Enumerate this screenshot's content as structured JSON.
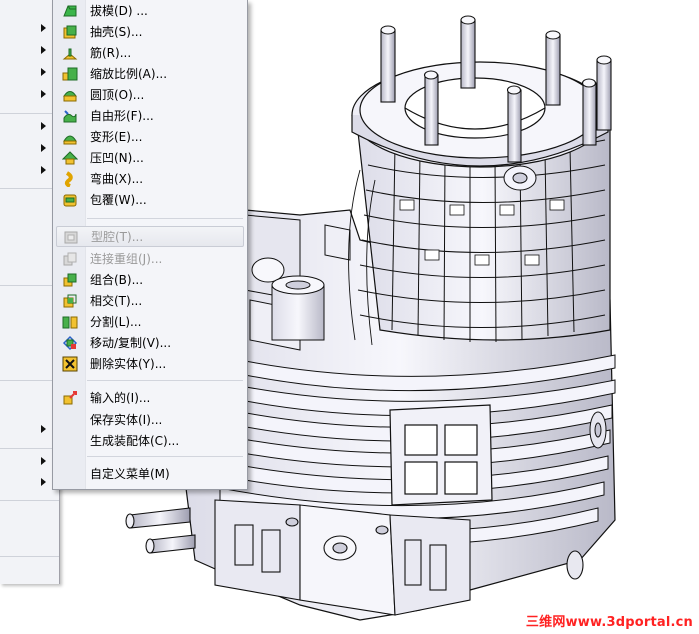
{
  "menu": {
    "items": [
      {
        "label": "拔模(D) ...",
        "icon": "draft-icon",
        "enabled": true
      },
      {
        "label": "抽壳(S)...",
        "icon": "shell-icon",
        "enabled": true
      },
      {
        "label": "筋(R)...",
        "icon": "rib-icon",
        "enabled": true
      },
      {
        "label": "缩放比例(A)...",
        "icon": "scale-icon",
        "enabled": true
      },
      {
        "label": "圆顶(O)...",
        "icon": "dome-icon",
        "enabled": true
      },
      {
        "label": "自由形(F)...",
        "icon": "freeform-icon",
        "enabled": true
      },
      {
        "label": "变形(E)...",
        "icon": "deform-icon",
        "enabled": true
      },
      {
        "label": "压凹(N)...",
        "icon": "indent-icon",
        "enabled": true
      },
      {
        "label": "弯曲(X)...",
        "icon": "flex-icon",
        "enabled": true
      },
      {
        "label": "包覆(W)...",
        "icon": "wrap-icon",
        "enabled": true
      },
      {
        "label": "型腔(T)...",
        "icon": "cavity-icon",
        "enabled": false
      },
      {
        "label": "连接重组(J)...",
        "icon": "join-icon",
        "enabled": false
      },
      {
        "label": "组合(B)...",
        "icon": "combine-icon",
        "enabled": true
      },
      {
        "label": "相交(T)...",
        "icon": "intersect-icon",
        "enabled": true
      },
      {
        "label": "分割(L)...",
        "icon": "split-icon",
        "enabled": true
      },
      {
        "label": "移动/复制(V)...",
        "icon": "move-copy-icon",
        "enabled": true
      },
      {
        "label": "删除实体(Y)...",
        "icon": "delete-body-icon",
        "enabled": true
      },
      {
        "label": "输入的(I)...",
        "icon": "imported-icon",
        "enabled": true
      },
      {
        "label": "保存实体(I)...",
        "icon": "save-bodies-icon",
        "enabled": true
      },
      {
        "label": "生成装配体(C)...",
        "icon": "create-assembly-icon",
        "enabled": true
      },
      {
        "label": "自定义菜单(M)",
        "icon": "",
        "enabled": true
      }
    ],
    "highlighted": "型腔(T)..."
  },
  "watermark": "三维网www.3dportal.cn",
  "colors": {
    "menu_bg": "#f4f5f9",
    "disabled_text": "#9a9a9a",
    "model_fill": "#f4f4fb",
    "model_shade": "#c9c9d6",
    "watermark": "#ff2222"
  }
}
